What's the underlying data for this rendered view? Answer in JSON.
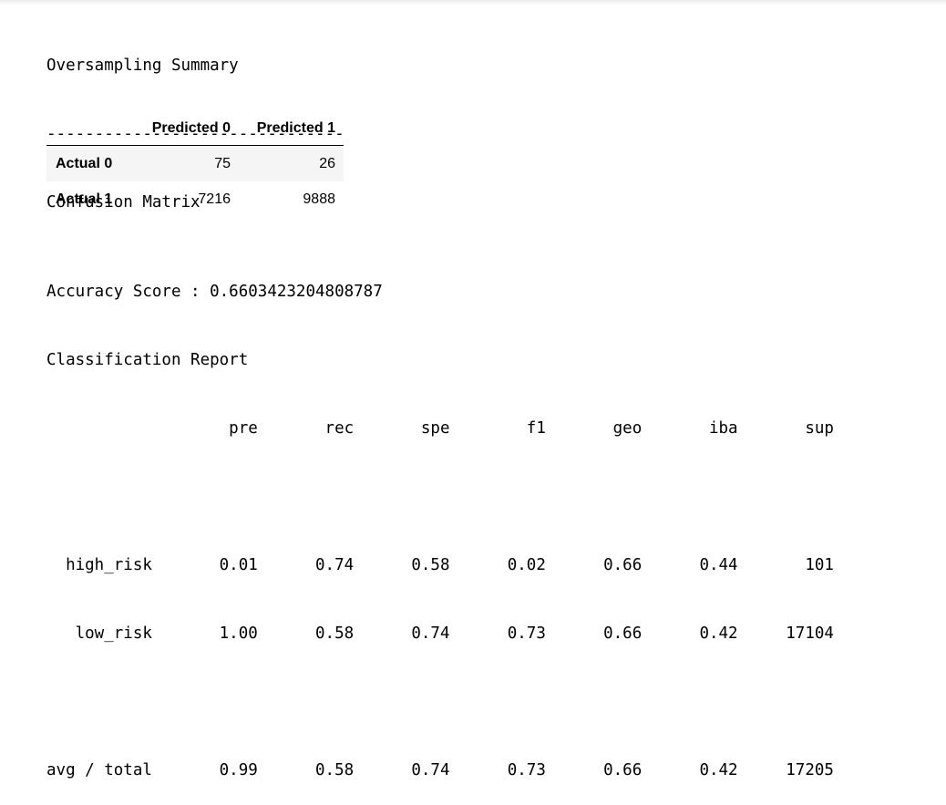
{
  "output": {
    "summary_title": "Oversampling Summary",
    "separator": "-------------------------------",
    "cm_title": "Confusion Matrix",
    "confusion_matrix": {
      "columns": [
        "Predicted 0",
        "Predicted 1"
      ],
      "rows": [
        {
          "label": "Actual 0",
          "values": [
            "75",
            "26"
          ]
        },
        {
          "label": "Actual 1",
          "values": [
            "7216",
            "9888"
          ]
        }
      ]
    },
    "accuracy_line": "Accuracy Score : 0.6603423204808787",
    "report_title": "Classification Report",
    "report_lines": [
      "                   pre       rec       spe        f1       geo       iba       sup",
      "",
      "  high_risk       0.01      0.74      0.58      0.02      0.66      0.44       101",
      "   low_risk       1.00      0.58      0.74      0.73      0.66      0.42     17104",
      "",
      "avg / total       0.99      0.58      0.74      0.73      0.66      0.42     17205"
    ]
  }
}
